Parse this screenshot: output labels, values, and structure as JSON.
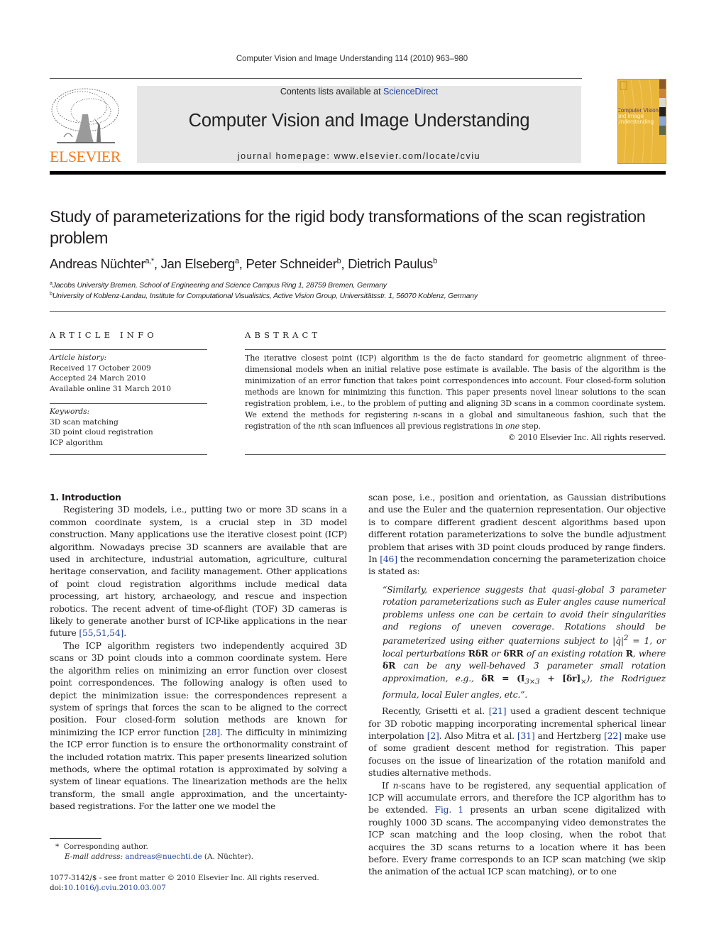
{
  "running_head": "Computer Vision and Image Understanding 114 (2010) 963–980",
  "publisher": {
    "logo_text": "ELSEVIER",
    "logo_color": "#f47d20"
  },
  "banner": {
    "contents_prefix": "Contents lists available at ",
    "contents_link": "ScienceDirect",
    "journal_title": "Computer Vision and Image Understanding",
    "homepage": "journal homepage: www.elsevier.com/locate/cviu"
  },
  "cover": {
    "line1": "Computer Vision",
    "line2": "and Image",
    "line3": "Understanding",
    "background": "#e9b73c"
  },
  "article": {
    "title": "Study of parameterizations for the rigid body transformations of the scan registration problem",
    "authors": [
      {
        "name": "Andreas Nüchter",
        "sup": "a,*"
      },
      {
        "name": "Jan Elseberg",
        "sup": "a"
      },
      {
        "name": "Peter Schneider",
        "sup": "b"
      },
      {
        "name": "Dietrich Paulus",
        "sup": "b"
      }
    ],
    "affiliations": [
      {
        "mark": "a",
        "text": "Jacobs University Bremen, School of Engineering and Science Campus Ring 1, 28759 Bremen, Germany"
      },
      {
        "mark": "b",
        "text": "University of Koblenz-Landau, Institute for Computational Visualistics, Active Vision Group, Universitätsstr. 1, 56070 Koblenz, Germany"
      }
    ]
  },
  "article_info": {
    "heading": "ARTICLE INFO",
    "history_label": "Article history:",
    "history": [
      "Received 17 October 2009",
      "Accepted 24 March 2010",
      "Available online 31 March 2010"
    ],
    "keywords_label": "Keywords:",
    "keywords": [
      "3D scan matching",
      "3D point cloud registration",
      "ICP algorithm"
    ]
  },
  "abstract": {
    "heading": "ABSTRACT",
    "text_1": "The iterative closest point (ICP) algorithm is the de facto standard for geometric alignment of three-dimensional models when an initial relative pose estimate is available. The basis of the algorithm is the minimization of an error function that takes point correspondences into account. Four closed-form solution methods are known for minimizing this function. This paper presents novel linear solutions to the scan registration problem, i.e., to the problem of putting and aligning 3D scans in a common coordinate system. We extend the methods for registering ",
    "n1": "n",
    "text_2": "-scans in a global and simultaneous fashion, such that the registration of the ",
    "n2": "n",
    "text_3": "th scan influences all previous registrations in ",
    "one": "one",
    "text_4": " step.",
    "copyright": "© 2010 Elsevier Inc. All rights reserved."
  },
  "body": {
    "section_heading": "1. Introduction",
    "p1": "Registering 3D models, i.e., putting two or more 3D scans in a common coordinate system, is a crucial step in 3D model construction. Many applications use the iterative closest point (ICP) algorithm. Nowadays precise 3D scanners are available that are used in architecture, industrial automation, agriculture, cultural heritage conservation, and facility management. Other applications of point cloud registration algorithms include medical data processing, art history, archaeology, and rescue and inspection robotics. The recent advent of time-of-flight (TOF) 3D cameras is likely to generate another burst of ICP-like applications in the near future ",
    "p1_ref": "[55,51,54]",
    "p2_a": "The ICP algorithm registers two independently acquired 3D scans or 3D point clouds into a common coordinate system. Here the algorithm relies on minimizing an error function over closest point correspondences. The following analogy is often used to depict the minimization issue: the correspondences represent a system of springs that forces the scan to be aligned to the correct position. Four closed-form solution methods are known for minimizing the ICP error function ",
    "p2_ref": "[28]",
    "p2_b": ". The difficulty in minimizing the ICP error function is to ensure the orthonormality constraint of the included rotation matrix. This paper presents linearized solution methods, where the optimal rotation is approximated by solving a system of linear equations. The linearization methods are the helix transform, the small angle approximation, and the uncertainty-based registrations. For the latter one we model the",
    "r1_a": "scan pose, i.e., position and orientation, as Gaussian distributions and use the Euler and the quaternion representation. Our objective is to compare different gradient descent algorithms based upon different rotation parameterizations to solve the bundle adjustment problem that arises with 3D point clouds produced by range finders. In ",
    "r1_ref": "[46]",
    "r1_b": " the recommendation concerning the parameterization choice is stated as:",
    "quote_a": "“Similarly, experience suggests that quasi-global 3 parameter rotation parameterizations such as Euler angles cause numerical problems unless one can be certain to avoid their singularities and regions of uneven coverage. Rotations should be parameterized using either quaternions subject to |q̇|",
    "quote_sq": "2",
    "quote_b": " = 1, or local perturbations ",
    "quote_m1": "RδR",
    "quote_c": " or ",
    "quote_m2": "δRR",
    "quote_d": " of an existing rotation ",
    "quote_m3": "R",
    "quote_e": ", where ",
    "quote_m4": "δR",
    "quote_f": " can be any well-behaved 3 parameter small rotation approximation, e.g., ",
    "quote_m5": "δR = (I",
    "quote_sub1": "3×3",
    "quote_m6": " + [δr]",
    "quote_sub2": "×",
    "quote_g": "), the Rodriguez formula, local Euler angles, etc.”.",
    "r2_a": "Recently, Grisetti et al. ",
    "r2_ref1": "[21]",
    "r2_b": " used a gradient descent technique for 3D robotic mapping incorporating incremental spherical linear interpolation ",
    "r2_ref2": "[2]",
    "r2_c": ". Also Mitra et al. ",
    "r2_ref3": "[31]",
    "r2_d": " and Hertzberg ",
    "r2_ref4": "[22]",
    "r2_e": " make use of some gradient descent method for registration. This paper focuses on the issue of linearization of the rotation manifold and studies alternative methods.",
    "r3_a": "If ",
    "r3_n": "n",
    "r3_b": "-scans have to be registered, any sequential application of ICP will accumulate errors, and therefore the ICP algorithm has to be extended. ",
    "r3_ref": "Fig. 1",
    "r3_c": " presents an urban scene digitalized with roughly 1000 3D scans. The accompanying video demonstrates the ICP scan matching and the loop closing, when the robot that acquires the 3D scans returns to a location where it has been before. Every frame corresponds to an ICP scan matching (we skip the animation of the actual ICP scan matching), or to one"
  },
  "footnotes": {
    "star": "*",
    "corresponding": "Corresponding author.",
    "email_label": "E-mail address:",
    "email": "andreas@nuechti.de",
    "email_suffix": " (A. Nüchter).",
    "issn": "1077-3142/$ - see front matter © 2010 Elsevier Inc. All rights reserved.",
    "doi_label": "doi:",
    "doi": "10.1016/j.cviu.2010.03.007"
  },
  "colors": {
    "link": "#1f3f9a",
    "banner_bg": "#e6e6e6"
  }
}
